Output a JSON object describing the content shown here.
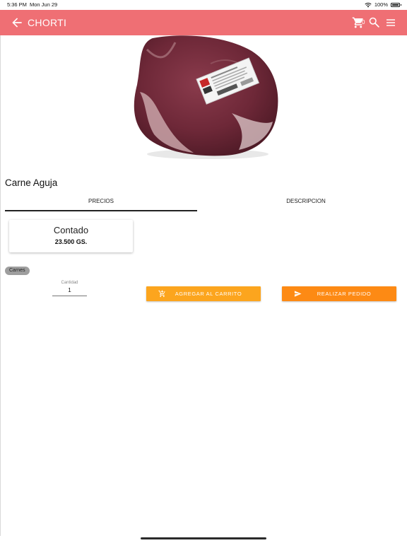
{
  "status_bar": {
    "time": "5:36 PM",
    "date": "Mon Jun 29",
    "battery": "100%"
  },
  "app_bar": {
    "title": "CHORTI",
    "cart_count": "0"
  },
  "product": {
    "name": "Carne Aguja",
    "tabs": [
      {
        "label": "PRECIOS"
      },
      {
        "label": "DESCRIPCION"
      }
    ],
    "price": {
      "label": "Contado",
      "amount": "23.500  GS."
    },
    "category": "Carnes"
  },
  "quantity": {
    "label": "Cantidad",
    "value": "1"
  },
  "actions": {
    "add_to_cart": "AGREGAR AL CARRITO",
    "place_order": "REALIZAR PEDIDO"
  },
  "colors": {
    "app_bar": "#ef6f74",
    "add_button": "#fca51e",
    "order_button": "#fd8a14",
    "chip": "#9e9e9e"
  },
  "icons": [
    "back-arrow-icon",
    "cart-icon",
    "search-icon",
    "menu-icon",
    "add-cart-icon",
    "send-icon",
    "wifi-icon",
    "battery-icon"
  ]
}
